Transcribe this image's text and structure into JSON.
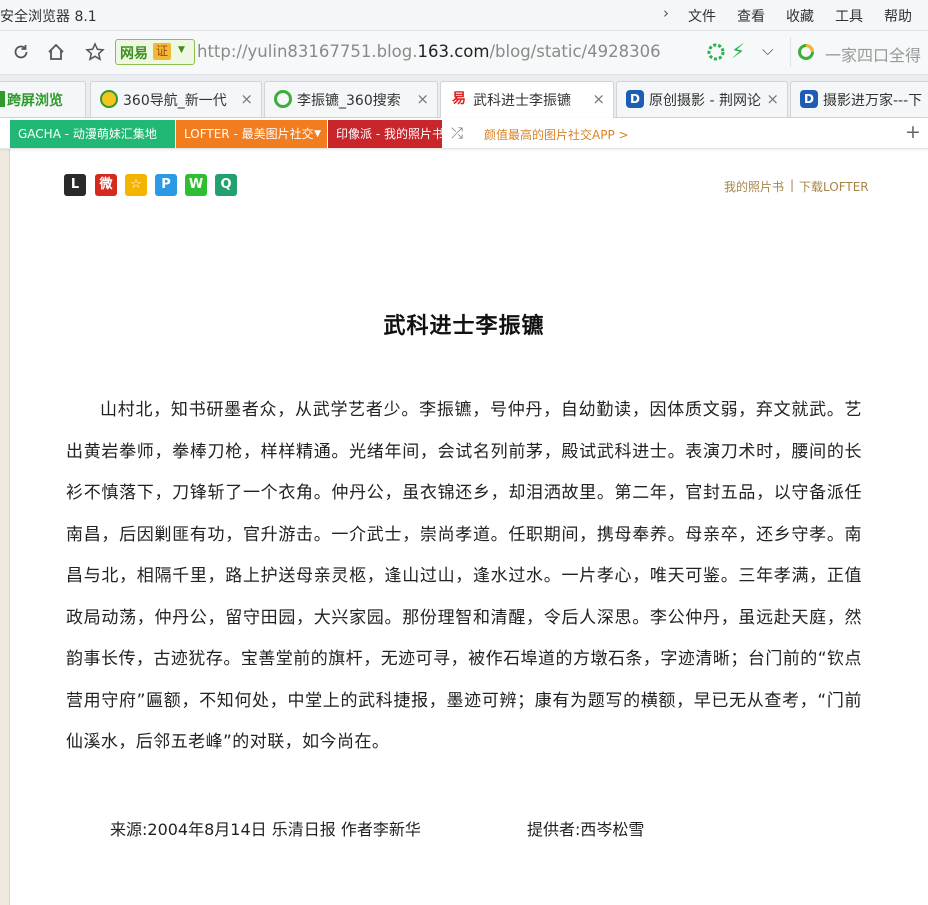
{
  "browser": {
    "title": "安全浏览器 8.1",
    "menu": [
      "文件",
      "查看",
      "收藏",
      "工具",
      "帮助"
    ]
  },
  "address_bar": {
    "badge_label": "网易",
    "cert_label": "证",
    "url_prefix": "http://yulin83167751.blog.",
    "url_domain": "163.com",
    "url_suffix": "/blog/static/4928306",
    "search_placeholder": "一家四口全得"
  },
  "tabs": [
    {
      "label": "跨屏浏览",
      "close": ""
    },
    {
      "label": "360导航_新一代",
      "close": "×"
    },
    {
      "label": "李振镳_360搜索",
      "close": "×"
    },
    {
      "label": "武科进士李振镳",
      "close": "×"
    },
    {
      "label": "原创摄影 - 荆网论",
      "close": "×"
    },
    {
      "label": "摄影进万家---下",
      "close": ""
    }
  ],
  "lofter_bar": {
    "gacha": "GACHA - 动漫萌妹汇集地",
    "lofter": "LOFTER - 最美图片社交",
    "yinxiang": "印像派 - 我的照片书",
    "app_promo": "颜值最高的图片社交APP >"
  },
  "page": {
    "share_buttons": [
      "L",
      "微",
      "☆",
      "P",
      "W",
      "Q"
    ],
    "album_link": "我的照片书",
    "separator": "|",
    "download_link": "下载LOFTER",
    "title": "武科进士李振镳",
    "body": "山村北，知书研墨者众，从武学艺者少。李振镳，号仲丹，自幼勤读，因体质文弱，弃文就武。艺出黄岩拳师，拳棒刀枪，样样精通。光绪年间，会试名列前茅，殿试武科进士。表演刀术时，腰间的长衫不慎落下，刀锋斩了一个衣角。仲丹公，虽衣锦还乡，却泪洒故里。第二年，官封五品，以守备派任南昌，后因剿匪有功，官升游击。一介武士，崇尚孝道。任职期间，携母奉养。母亲卒，还乡守孝。南昌与北，相隔千里，路上护送母亲灵柩，逢山过山，逢水过水。一片孝心，唯天可鉴。三年孝满，正值政局动荡，仲丹公，留守田园，大兴家园。那份理智和清醒，令后人深思。李公仲丹，虽远赴天庭，然韵事长传，古迹犹存。宝善堂前的旗杆，无迹可寻，被作石埠道的方墩石条，字迹清晰；台门前的“钦点营用守府”匾额，不知何处，中堂上的武科捷报，墨迹可辨；康有为题写的横额，早已无从查考，“门前仙溪水，后邻五老峰”的对联，如今尚在。",
    "source": "来源:2004年8月14日  乐清日报  作者李新华",
    "provider": "提供者:西岑松雪"
  },
  "colors": {
    "gacha_green": "#20b874",
    "lofter_orange": "#f27d1e",
    "yinxiang_red": "#c9262c",
    "link_gold": "#a68449"
  }
}
